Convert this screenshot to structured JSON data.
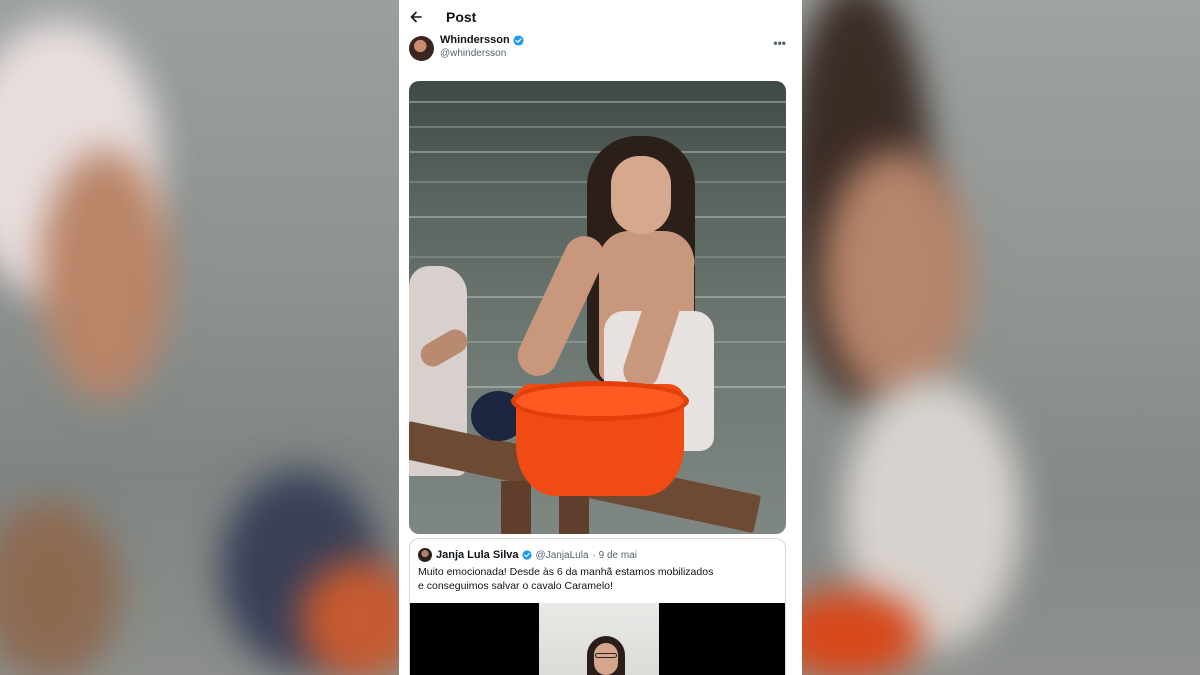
{
  "header": {
    "title": "Post"
  },
  "post": {
    "author_name": "Whindersson",
    "author_handle": "@whindersson",
    "media_description_icon": "video-frame"
  },
  "quote": {
    "author_name": "Janja Lula Silva",
    "author_handle": "@JanjaLula",
    "date": "· 9 de mai",
    "text": "Muito emocionada! Desde às 6 da manhã estamos mobilizados e conseguimos salvar o cavalo Caramelo!"
  },
  "icons": {
    "back": "arrow-left-icon",
    "verified": "verified-badge-icon",
    "more": "more-options-icon"
  },
  "colors": {
    "verified": "#1d9bf0",
    "text_primary": "#0f1419",
    "text_secondary": "#536471",
    "border": "#cfd9de"
  }
}
